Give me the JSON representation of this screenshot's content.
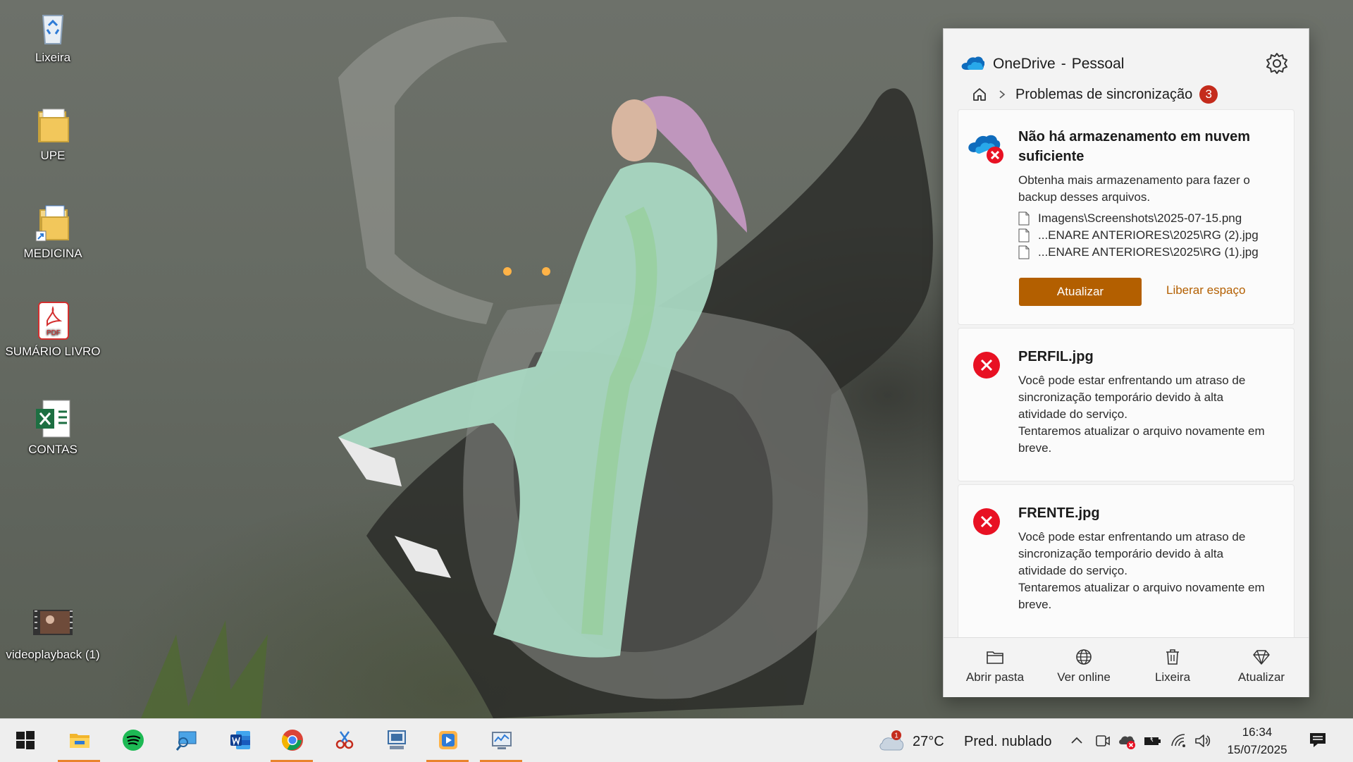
{
  "desktop": {
    "icons": [
      {
        "label": "Lixeira",
        "icon": "recycle-bin-icon"
      },
      {
        "label": "UPE",
        "icon": "folder-icon"
      },
      {
        "label": "MEDICINA",
        "icon": "folder-shortcut-icon"
      },
      {
        "label": "SUMÁRIO LIVRO",
        "icon": "pdf-file-icon"
      },
      {
        "label": "CONTAS",
        "icon": "excel-file-icon"
      },
      {
        "label": "videoplayback (1)",
        "icon": "video-file-icon"
      }
    ]
  },
  "onedrive": {
    "app_name": "OneDrive",
    "separator": "-",
    "account": "Pessoal",
    "breadcrumb": "Problemas de sincronização",
    "issue_count": "3",
    "accent": "#b35f00",
    "error_color": "#e81123",
    "cards": [
      {
        "title_line1": "Não há armazenamento em nuvem",
        "title_line2": "suficiente",
        "body_line1": "Obtenha mais armazenamento para fazer o",
        "body_line2": "backup desses arquivos.",
        "files": [
          "Imagens\\Screenshots\\2025-07-15.png",
          "...ENARE ANTERIORES\\2025\\RG (2).jpg",
          "...ENARE ANTERIORES\\2025\\RG (1).jpg"
        ],
        "primary_button": "Atualizar",
        "link_button": "Liberar espaço"
      },
      {
        "title": "PERFIL.jpg",
        "lines": [
          "Você pode estar enfrentando um atraso de",
          "sincronização temporário devido à alta",
          "atividade do serviço.",
          "Tentaremos atualizar o arquivo novamente em",
          "breve."
        ]
      },
      {
        "title": "FRENTE.jpg",
        "lines": [
          "Você pode estar enfrentando um atraso de",
          "sincronização temporário devido à alta",
          "atividade do serviço.",
          "Tentaremos atualizar o arquivo novamente em",
          "breve."
        ]
      }
    ],
    "footer": [
      {
        "label": "Abrir pasta",
        "icon": "folder-icon"
      },
      {
        "label": "Ver online",
        "icon": "globe-icon"
      },
      {
        "label": "Lixeira",
        "icon": "trash-icon"
      },
      {
        "label": "Atualizar",
        "icon": "diamond-icon"
      }
    ]
  },
  "taskbar": {
    "apps": [
      {
        "name": "start",
        "icon": "windows-logo-icon"
      },
      {
        "name": "file-explorer",
        "icon": "file-explorer-icon"
      },
      {
        "name": "spotify",
        "icon": "spotify-icon"
      },
      {
        "name": "remote-desktop",
        "icon": "remote-desktop-icon"
      },
      {
        "name": "word",
        "icon": "word-icon"
      },
      {
        "name": "chrome",
        "icon": "chrome-icon"
      },
      {
        "name": "snipping-tool",
        "icon": "snipping-tool-icon"
      },
      {
        "name": "monitor-app",
        "icon": "monitor-app-icon"
      },
      {
        "name": "media-player",
        "icon": "media-player-icon"
      },
      {
        "name": "performance-monitor",
        "icon": "performance-monitor-icon"
      }
    ],
    "weather": {
      "badge": "1",
      "temp": "27°C",
      "desc": "Pred. nublado"
    },
    "tray": [
      "chevron-up-icon",
      "camera-icon",
      "onedrive-error-icon",
      "battery-icon",
      "wifi-icon",
      "volume-icon"
    ],
    "time": "16:34",
    "date": "15/07/2025"
  }
}
